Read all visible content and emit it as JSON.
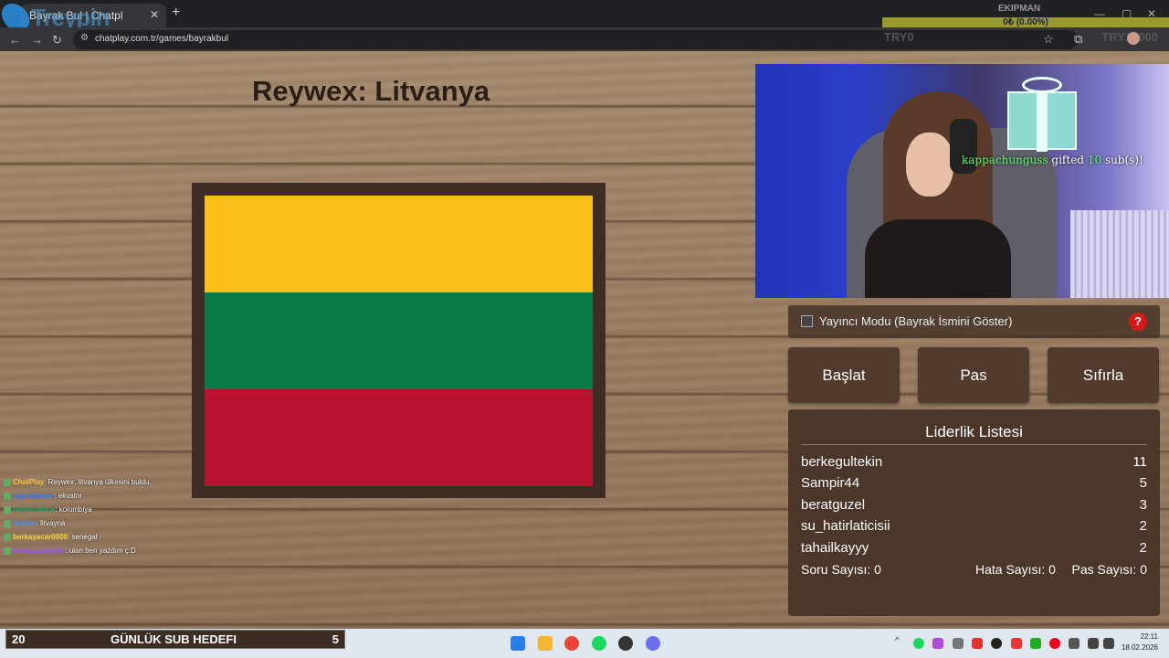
{
  "browser": {
    "tab_title": "Bayrak Bul | Chatpl",
    "url": "chatplay.com.tr/games/bayrakbul",
    "logo_text": "Treypin"
  },
  "donation": {
    "title": "EKIPMAN",
    "progress_text": "0₺ (0.00%)",
    "progress": 0.0,
    "min": "TRY0",
    "max": "TRY10000"
  },
  "game": {
    "title": "Reywex: Litvanya",
    "flag_colors": [
      "#f9be1a",
      "#0a7b46",
      "#b7132f"
    ]
  },
  "chat": [
    {
      "user": "ChatPlay",
      "message": ": Reywex, litvanya ülkesini buldu.",
      "color": "#f3c23b"
    },
    {
      "user": "ugurbabavv",
      "message": ": ekvator",
      "color": "#2f79ff"
    },
    {
      "user": "berkecakirw",
      "message": ": kolombiya",
      "color": "#1fa86f"
    },
    {
      "user": "Tayfun",
      "message": ": litvayna",
      "color": "#3b8fff"
    },
    {
      "user": "berkayacar0000",
      "message": ": senegal",
      "color": "#f2d23a"
    },
    {
      "user": "melaaanhyaslo",
      "message": ": ulan ben yazdım ç.D",
      "color": "#9b4dff"
    }
  ],
  "webcam": {
    "gift_user": "kappachunguss",
    "gift_text": "gifted",
    "gift_count": "10",
    "gift_suffix": "sub(s)!"
  },
  "panel": {
    "mode_label": "Yayıncı Modu (Bayrak İsmini Göster)",
    "help": "?",
    "buttons": {
      "start": "Başlat",
      "pass": "Pas",
      "reset": "Sıfırla"
    }
  },
  "leaderboard": {
    "title": "Liderlik Listesi",
    "rows": [
      {
        "name": "berkegultekin",
        "score": "11"
      },
      {
        "name": "Sampir44",
        "score": "5"
      },
      {
        "name": "beratguzel",
        "score": "3"
      },
      {
        "name": "su_hatirlaticisii",
        "score": "2"
      },
      {
        "name": "tahailkayyy",
        "score": "2"
      }
    ],
    "questions": "Soru Sayısı: 0",
    "errors": "Hata Sayısı: 0",
    "passes": "Pas Sayısı: 0"
  },
  "subgoal": {
    "current": "20",
    "label": "GÜNLÜK SUB HEDEFI",
    "target": "5"
  },
  "clock": {
    "time": "22:11",
    "date": "18.02.2026"
  }
}
